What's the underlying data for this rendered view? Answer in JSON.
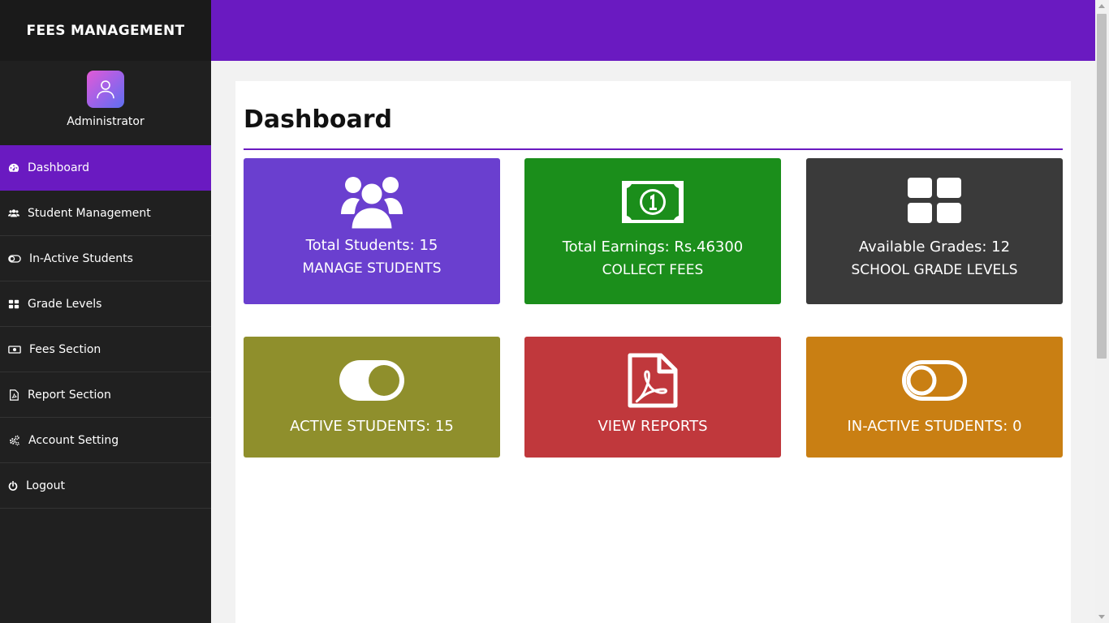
{
  "brand": {
    "title": "FEES MANAGEMENT"
  },
  "profile": {
    "name": "Administrator",
    "avatar_icon": "user-avatar-icon"
  },
  "colors": {
    "accent": "#6a1ac1",
    "sidebar_bg": "#202020",
    "card_students": "#6a3fcf",
    "card_earnings": "#1b8e1b",
    "card_grades": "#3a3a3a",
    "card_active": "#8f8f2c",
    "card_reports": "#c0383c",
    "card_inactive": "#c97f13"
  },
  "sidebar": {
    "items": [
      {
        "label": "Dashboard",
        "icon": "dashboard-icon",
        "active": true
      },
      {
        "label": "Student Management",
        "icon": "users-icon"
      },
      {
        "label": "In-Active Students",
        "icon": "toggle-off-icon"
      },
      {
        "label": "Grade Levels",
        "icon": "grid-icon"
      },
      {
        "label": "Fees Section",
        "icon": "money-icon"
      },
      {
        "label": "Report Section",
        "icon": "pdf-file-icon"
      },
      {
        "label": "Account Setting",
        "icon": "gears-icon"
      },
      {
        "label": "Logout",
        "icon": "power-icon"
      }
    ]
  },
  "main": {
    "title": "Dashboard",
    "cards": [
      {
        "line1": "Total Students: 15",
        "line2": "MANAGE STUDENTS",
        "icon": "users-icon"
      },
      {
        "line1": "Total Earnings: Rs.46300",
        "line2": "COLLECT FEES",
        "icon": "money-bill-icon"
      },
      {
        "line1": "Available Grades: 12",
        "line2": "SCHOOL GRADE LEVELS",
        "icon": "grid-icon"
      },
      {
        "line1": "ACTIVE STUDENTS: 15",
        "icon": "toggle-on-icon"
      },
      {
        "line1": "VIEW REPORTS",
        "icon": "pdf-file-icon"
      },
      {
        "line1": "IN-ACTIVE STUDENTS: 0",
        "icon": "toggle-off-icon"
      }
    ]
  }
}
